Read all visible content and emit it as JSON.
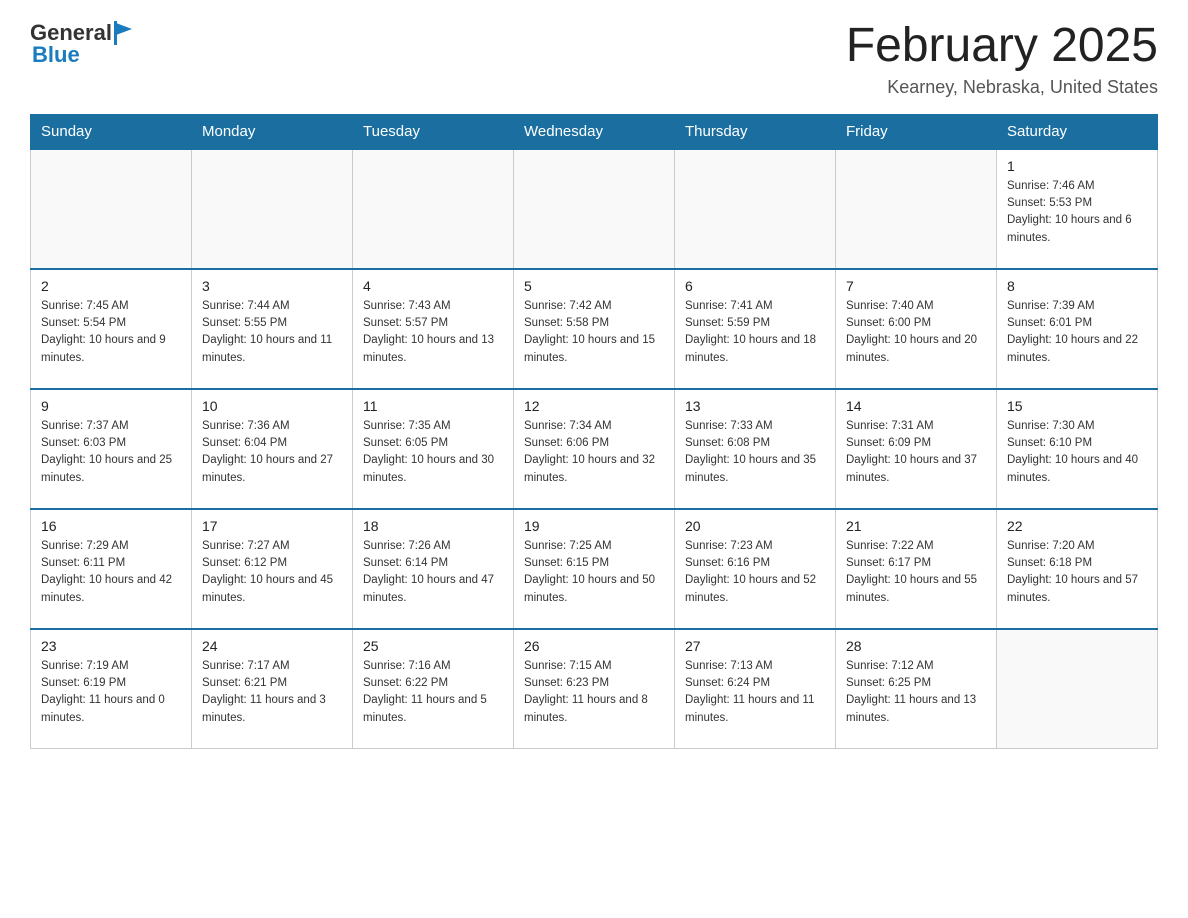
{
  "header": {
    "logo_general": "General",
    "logo_blue": "Blue",
    "title": "February 2025",
    "location": "Kearney, Nebraska, United States"
  },
  "days_of_week": [
    "Sunday",
    "Monday",
    "Tuesday",
    "Wednesday",
    "Thursday",
    "Friday",
    "Saturday"
  ],
  "weeks": [
    [
      {
        "day": "",
        "info": ""
      },
      {
        "day": "",
        "info": ""
      },
      {
        "day": "",
        "info": ""
      },
      {
        "day": "",
        "info": ""
      },
      {
        "day": "",
        "info": ""
      },
      {
        "day": "",
        "info": ""
      },
      {
        "day": "1",
        "info": "Sunrise: 7:46 AM\nSunset: 5:53 PM\nDaylight: 10 hours and 6 minutes."
      }
    ],
    [
      {
        "day": "2",
        "info": "Sunrise: 7:45 AM\nSunset: 5:54 PM\nDaylight: 10 hours and 9 minutes."
      },
      {
        "day": "3",
        "info": "Sunrise: 7:44 AM\nSunset: 5:55 PM\nDaylight: 10 hours and 11 minutes."
      },
      {
        "day": "4",
        "info": "Sunrise: 7:43 AM\nSunset: 5:57 PM\nDaylight: 10 hours and 13 minutes."
      },
      {
        "day": "5",
        "info": "Sunrise: 7:42 AM\nSunset: 5:58 PM\nDaylight: 10 hours and 15 minutes."
      },
      {
        "day": "6",
        "info": "Sunrise: 7:41 AM\nSunset: 5:59 PM\nDaylight: 10 hours and 18 minutes."
      },
      {
        "day": "7",
        "info": "Sunrise: 7:40 AM\nSunset: 6:00 PM\nDaylight: 10 hours and 20 minutes."
      },
      {
        "day": "8",
        "info": "Sunrise: 7:39 AM\nSunset: 6:01 PM\nDaylight: 10 hours and 22 minutes."
      }
    ],
    [
      {
        "day": "9",
        "info": "Sunrise: 7:37 AM\nSunset: 6:03 PM\nDaylight: 10 hours and 25 minutes."
      },
      {
        "day": "10",
        "info": "Sunrise: 7:36 AM\nSunset: 6:04 PM\nDaylight: 10 hours and 27 minutes."
      },
      {
        "day": "11",
        "info": "Sunrise: 7:35 AM\nSunset: 6:05 PM\nDaylight: 10 hours and 30 minutes."
      },
      {
        "day": "12",
        "info": "Sunrise: 7:34 AM\nSunset: 6:06 PM\nDaylight: 10 hours and 32 minutes."
      },
      {
        "day": "13",
        "info": "Sunrise: 7:33 AM\nSunset: 6:08 PM\nDaylight: 10 hours and 35 minutes."
      },
      {
        "day": "14",
        "info": "Sunrise: 7:31 AM\nSunset: 6:09 PM\nDaylight: 10 hours and 37 minutes."
      },
      {
        "day": "15",
        "info": "Sunrise: 7:30 AM\nSunset: 6:10 PM\nDaylight: 10 hours and 40 minutes."
      }
    ],
    [
      {
        "day": "16",
        "info": "Sunrise: 7:29 AM\nSunset: 6:11 PM\nDaylight: 10 hours and 42 minutes."
      },
      {
        "day": "17",
        "info": "Sunrise: 7:27 AM\nSunset: 6:12 PM\nDaylight: 10 hours and 45 minutes."
      },
      {
        "day": "18",
        "info": "Sunrise: 7:26 AM\nSunset: 6:14 PM\nDaylight: 10 hours and 47 minutes."
      },
      {
        "day": "19",
        "info": "Sunrise: 7:25 AM\nSunset: 6:15 PM\nDaylight: 10 hours and 50 minutes."
      },
      {
        "day": "20",
        "info": "Sunrise: 7:23 AM\nSunset: 6:16 PM\nDaylight: 10 hours and 52 minutes."
      },
      {
        "day": "21",
        "info": "Sunrise: 7:22 AM\nSunset: 6:17 PM\nDaylight: 10 hours and 55 minutes."
      },
      {
        "day": "22",
        "info": "Sunrise: 7:20 AM\nSunset: 6:18 PM\nDaylight: 10 hours and 57 minutes."
      }
    ],
    [
      {
        "day": "23",
        "info": "Sunrise: 7:19 AM\nSunset: 6:19 PM\nDaylight: 11 hours and 0 minutes."
      },
      {
        "day": "24",
        "info": "Sunrise: 7:17 AM\nSunset: 6:21 PM\nDaylight: 11 hours and 3 minutes."
      },
      {
        "day": "25",
        "info": "Sunrise: 7:16 AM\nSunset: 6:22 PM\nDaylight: 11 hours and 5 minutes."
      },
      {
        "day": "26",
        "info": "Sunrise: 7:15 AM\nSunset: 6:23 PM\nDaylight: 11 hours and 8 minutes."
      },
      {
        "day": "27",
        "info": "Sunrise: 7:13 AM\nSunset: 6:24 PM\nDaylight: 11 hours and 11 minutes."
      },
      {
        "day": "28",
        "info": "Sunrise: 7:12 AM\nSunset: 6:25 PM\nDaylight: 11 hours and 13 minutes."
      },
      {
        "day": "",
        "info": ""
      }
    ]
  ]
}
